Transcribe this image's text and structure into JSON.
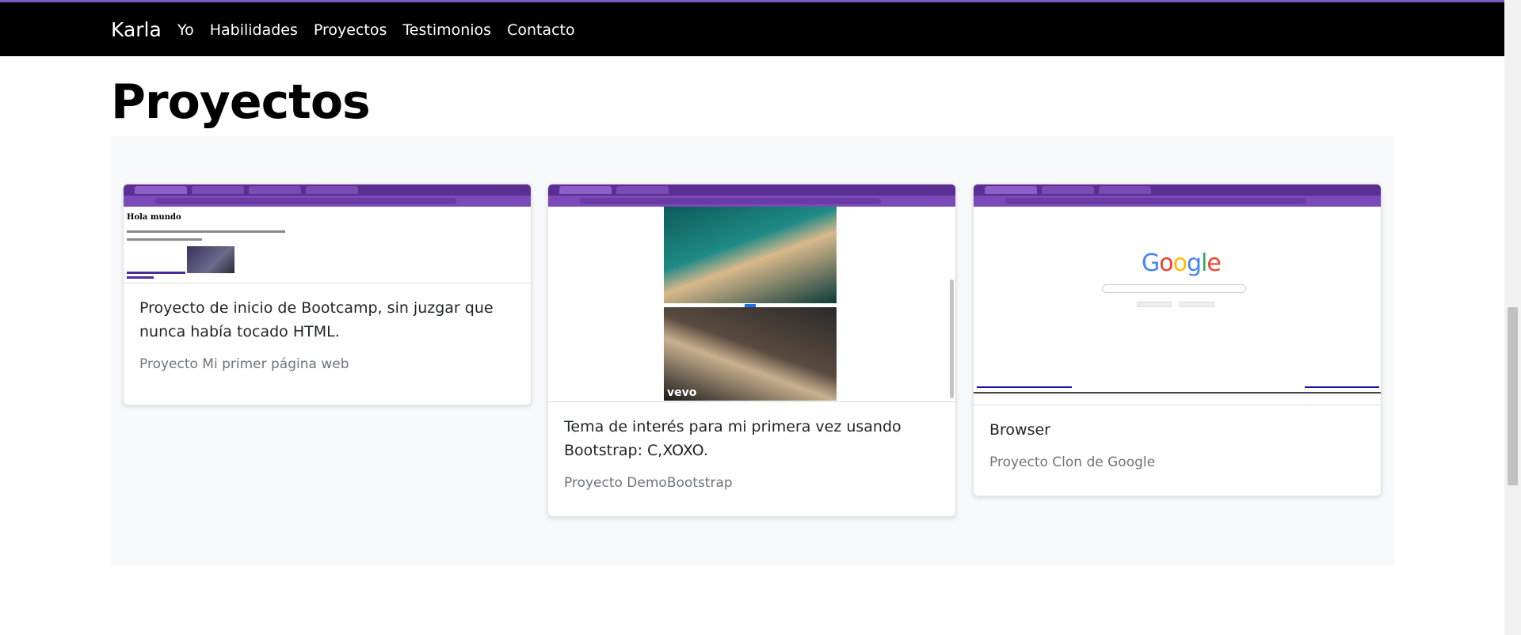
{
  "nav": {
    "brand": "Karla",
    "links": [
      "Yo",
      "Habilidades",
      "Proyectos",
      "Testimonios",
      "Contacto"
    ]
  },
  "section": {
    "title": "Proyectos"
  },
  "cards": [
    {
      "text": "Proyecto de inicio de Bootcamp, sin juzgar que nunca había tocado HTML.",
      "muted": "Proyecto Mi primer página web",
      "screenshot_heading": "Hola mundo"
    },
    {
      "text": "Tema de interés para mi primera vez usando Bootstrap: C,XOXO.",
      "muted": "Proyecto DemoBootstrap",
      "screenshot_badge": "vevo"
    },
    {
      "text": "Browser",
      "muted": "Proyecto Clon de Google",
      "screenshot_logo": "Google"
    }
  ],
  "colors": {
    "navbar": "#000000",
    "accent": "#7e57c2",
    "section_bg": "#f8f9fa",
    "muted_text": "#6c757d"
  }
}
